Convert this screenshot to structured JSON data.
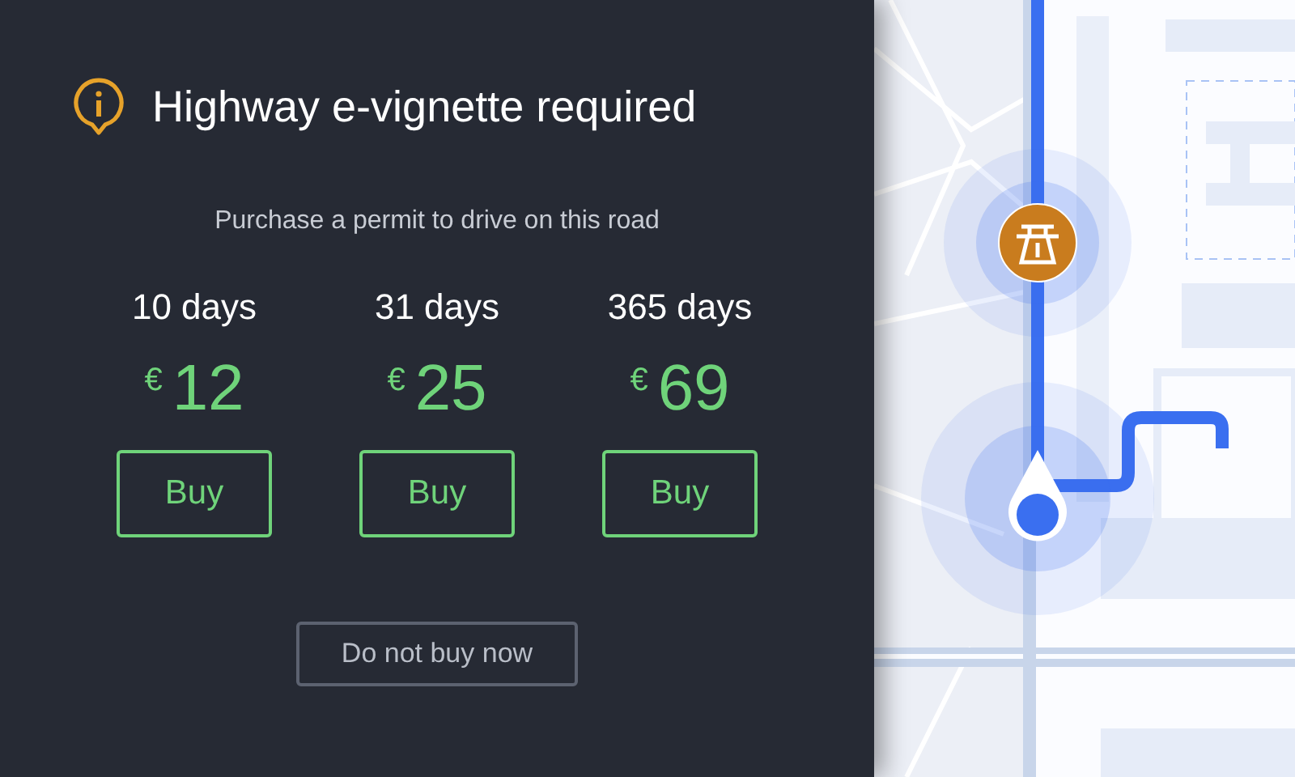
{
  "title": "Highway e-vignette required",
  "subtitle": "Purchase a permit to drive on this road",
  "options": [
    {
      "duration": "10 days",
      "currency": "€",
      "price": "12",
      "button": "Buy"
    },
    {
      "duration": "31 days",
      "currency": "€",
      "price": "25",
      "button": "Buy"
    },
    {
      "duration": "365 days",
      "currency": "€",
      "price": "69",
      "button": "Buy"
    }
  ],
  "dismiss": "Do not buy now"
}
